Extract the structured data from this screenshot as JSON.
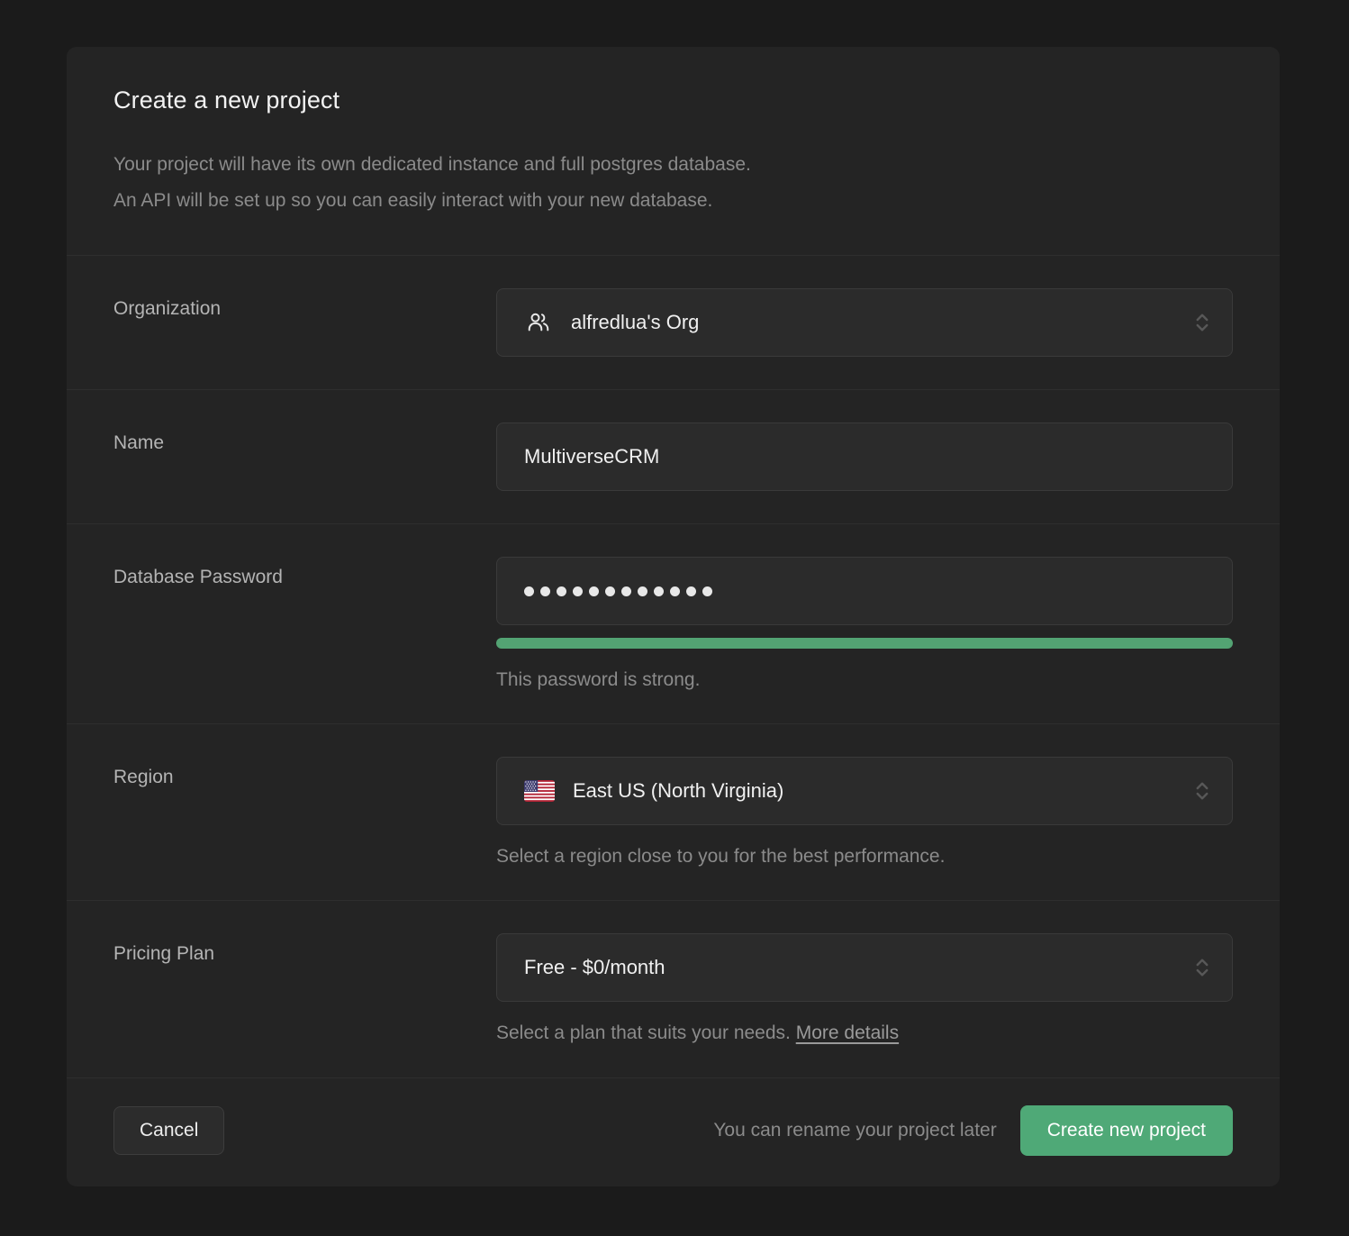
{
  "dialog": {
    "title": "Create a new project",
    "description_line1": "Your project will have its own dedicated instance and full postgres database.",
    "description_line2": "An API will be set up so you can easily interact with your new database."
  },
  "organization": {
    "label": "Organization",
    "value": "alfredlua's Org",
    "icon": "users-icon"
  },
  "name": {
    "label": "Name",
    "value": "MultiverseCRM",
    "placeholder": "Project name"
  },
  "password": {
    "label": "Database Password",
    "masked_value": "••••••••••••",
    "dot_count": 12,
    "placeholder": "Type in a strong password",
    "strength_text": "This password is strong.",
    "strength_percent": 100,
    "strength_color": "#53a373"
  },
  "region": {
    "label": "Region",
    "value": "East US (North Virginia)",
    "icon": "us-flag-icon",
    "helper": "Select a region close to you for the best performance."
  },
  "pricing": {
    "label": "Pricing Plan",
    "value": "Free - $0/month",
    "helper_text": "Select a plan that suits your needs.",
    "helper_link": "More details"
  },
  "footer": {
    "cancel_label": "Cancel",
    "note": "You can rename your project later",
    "submit_label": "Create new project",
    "submit_color": "#4fa977"
  }
}
